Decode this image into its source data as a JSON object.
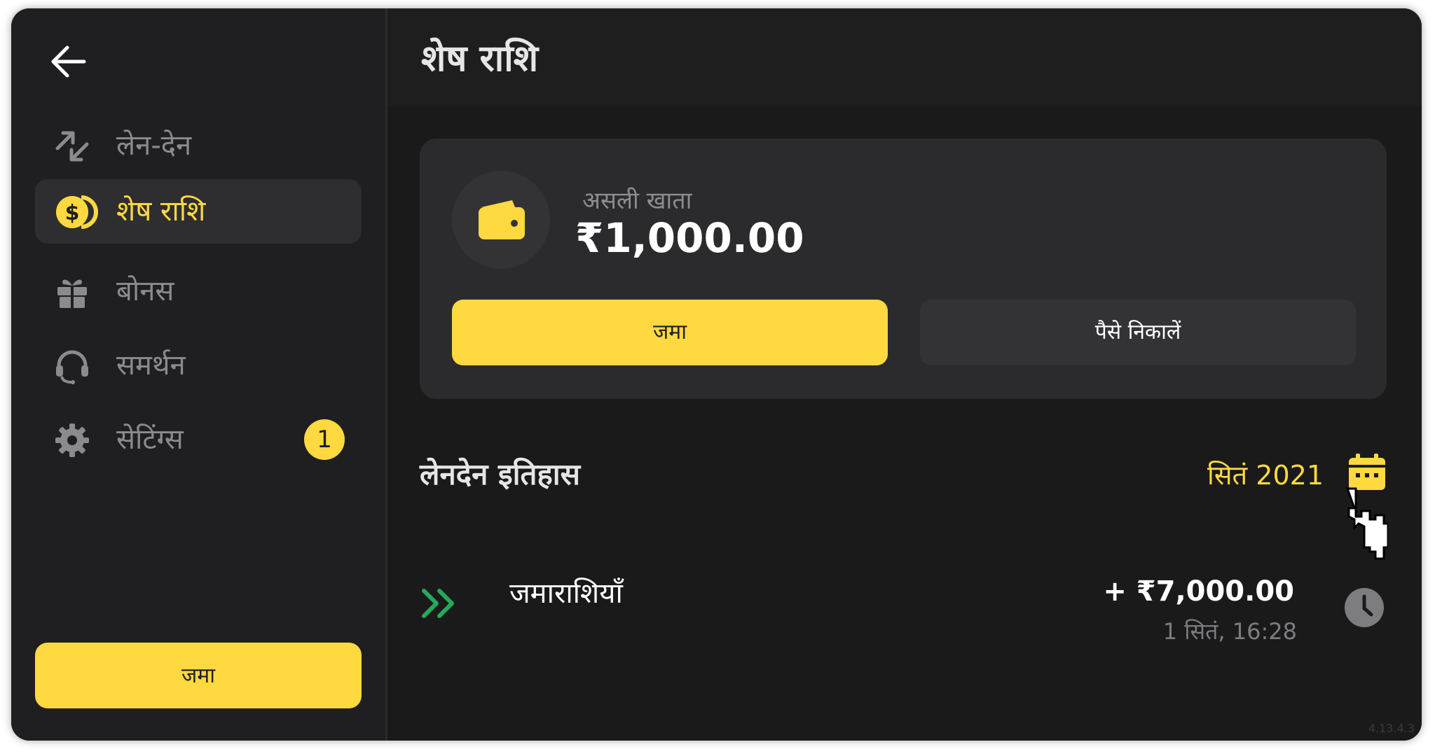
{
  "sidebar": {
    "back_icon": "arrow-left-icon",
    "items": [
      {
        "label": "लेन-देन",
        "icon": "transactions-icon"
      },
      {
        "label": "शेष राशि",
        "icon": "balance-icon",
        "active": true
      },
      {
        "label": "बोनस",
        "icon": "gift-icon"
      },
      {
        "label": "समर्थन",
        "icon": "headset-icon"
      },
      {
        "label": "सेटिंग्स",
        "icon": "gear-icon",
        "badge": "1"
      }
    ],
    "deposit_label": "जमा"
  },
  "header": {
    "title": "शेष राशि"
  },
  "balance_card": {
    "wallet_icon": "wallet-icon",
    "account_label": "असली खाता",
    "amount": "₹1,000.00",
    "deposit_label": "जमा",
    "withdraw_label": "पैसे निकालें"
  },
  "history": {
    "title": "लेनदेन इतिहास",
    "month": "सितं 2021",
    "calendar_icon": "calendar-icon",
    "transactions": [
      {
        "label": "जमाराशियाँ",
        "amount": "+ ₹7,000.00",
        "date": "1 सितं, 16:28",
        "icon": "double-chevron-right-icon",
        "status_icon": "clock-icon"
      }
    ]
  },
  "version": "4.13.4.3",
  "colors": {
    "accent": "#ffd93f",
    "background": "#1a1a1b",
    "sidebar": "#1f1f21",
    "card": "#2b2b2d",
    "deposit_arrow": "#25a85a"
  }
}
